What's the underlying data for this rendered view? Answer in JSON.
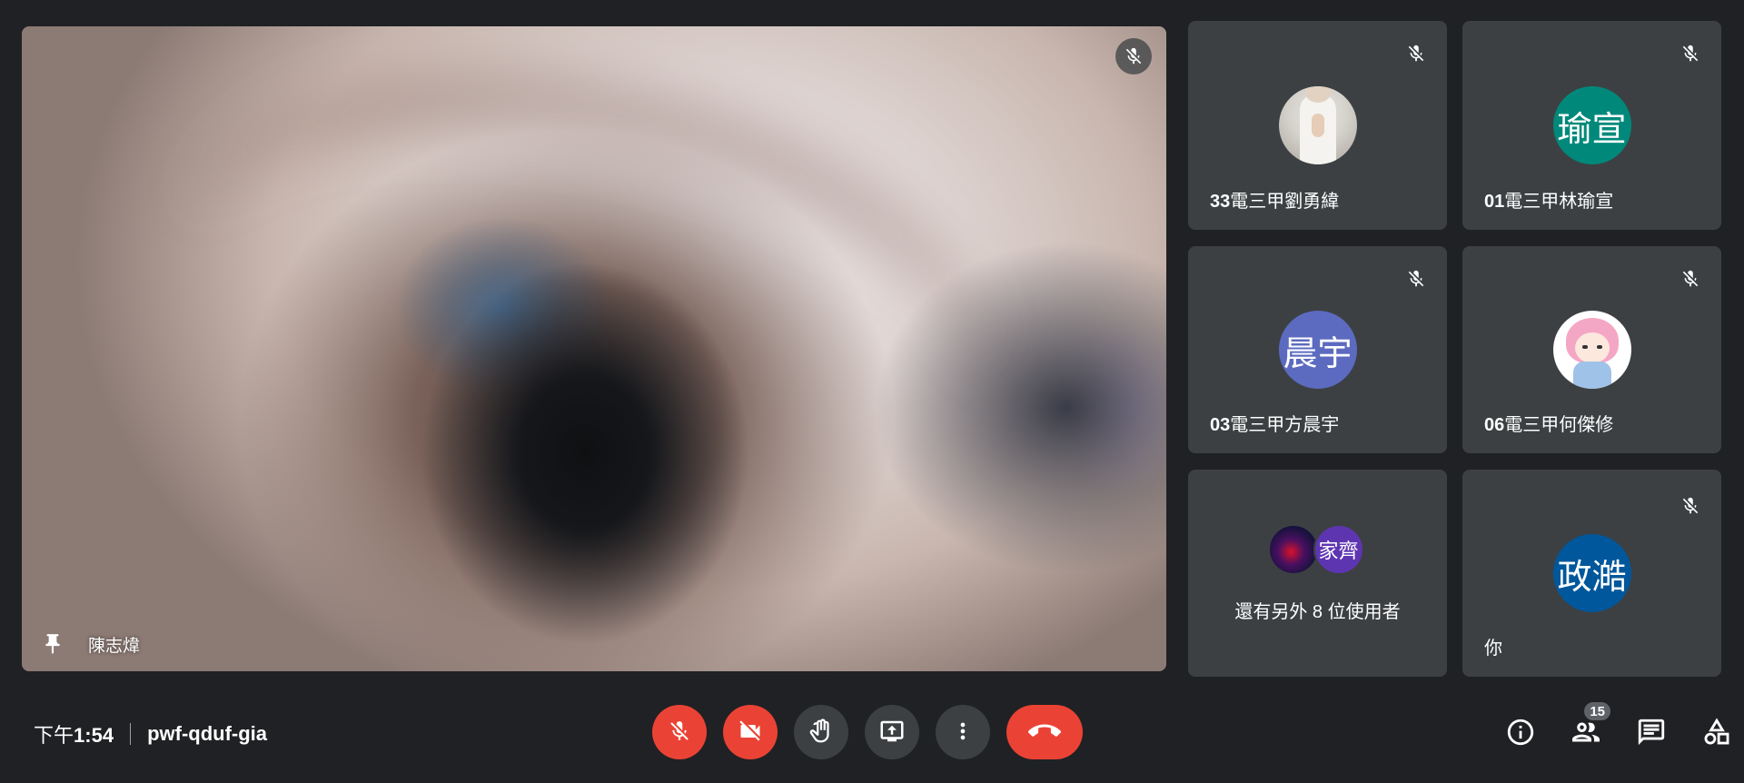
{
  "main_video": {
    "name": "陳志煒",
    "pin_icon": "pin-icon",
    "mute_icon": "mic-off-icon"
  },
  "tiles": [
    {
      "prefix": "33",
      "name": "電三甲劉勇緯",
      "avatar_type": "photo"
    },
    {
      "prefix": "01",
      "name": "電三甲林瑜宣",
      "avatar_text": "瑜宣",
      "avatar_color": "#00897b"
    },
    {
      "prefix": "03",
      "name": "電三甲方晨宇",
      "avatar_text": "晨宇",
      "avatar_color": "#5c6bc0"
    },
    {
      "prefix": "06",
      "name": "電三甲何傑修",
      "avatar_type": "anime"
    },
    {
      "more_text": "還有另外 8 位使用者",
      "avatar_text": "家齊",
      "avatar_color": "#5e35b1"
    },
    {
      "name": "你",
      "avatar_text": "政澔",
      "avatar_color": "#01579b"
    }
  ],
  "meeting": {
    "time_prefix": "下午",
    "time": "1:54",
    "code": "pwf-qduf-gia"
  },
  "controls": {
    "mic": "mic-off-icon",
    "camera": "videocam-off-icon",
    "raise_hand": "hand-icon",
    "present": "present-screen-icon",
    "more": "more-vert-icon",
    "hangup": "call-end-icon"
  },
  "right_bar": {
    "participants_count": "15",
    "icons": [
      "info-icon",
      "people-icon",
      "chat-icon",
      "activities-icon"
    ]
  },
  "colors": {
    "background": "#202124",
    "tile": "#3c4043",
    "danger": "#ea4335"
  }
}
